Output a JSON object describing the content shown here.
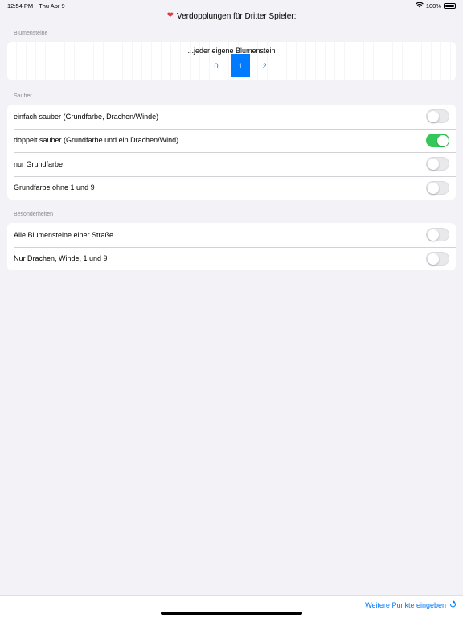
{
  "status": {
    "time": "12:54 PM",
    "date": "Thu Apr 9",
    "battery": "100%"
  },
  "nav": {
    "title": "Verdopplungen für Dritter Spieler:"
  },
  "sections": {
    "blumensteine": {
      "header": "Blumensteine",
      "segment_title": "...jeder eigene Blumenstein",
      "options": [
        "0",
        "1",
        "2"
      ],
      "selected": "1"
    },
    "sauber": {
      "header": "Sauber",
      "rows": [
        {
          "label": "einfach sauber (Grundfarbe, Drachen/Winde)",
          "on": false
        },
        {
          "label": "doppelt sauber (Grundfarbe und ein Drachen/Wind)",
          "on": true
        },
        {
          "label": "nur Grundfarbe",
          "on": false
        },
        {
          "label": "Grundfarbe ohne 1 und 9",
          "on": false
        }
      ]
    },
    "besonderheiten": {
      "header": "Besonderheiten",
      "rows": [
        {
          "label": "Alle Blumensteine einer Straße",
          "on": false
        },
        {
          "label": "Nur Drachen, Winde, 1 und 9",
          "on": false
        }
      ]
    }
  },
  "bottom": {
    "link_label": "Weitere Punkte eingeben"
  },
  "colors": {
    "accent": "#007aff",
    "toggle_on": "#34c759",
    "heart": "#e0393e"
  }
}
